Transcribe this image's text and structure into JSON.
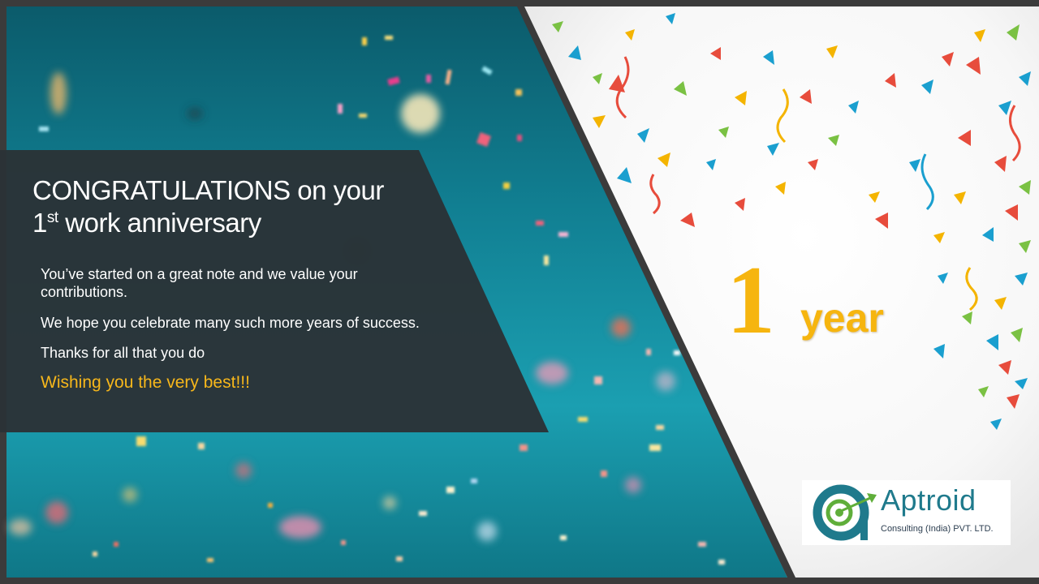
{
  "card": {
    "title_line1": "CONGRATULATIONS on your",
    "title_line2_prefix": "1",
    "title_line2_sup": "st",
    "title_line2_rest": " work anniversary",
    "paragraph1": "You’ve started on a great note and we value your contributions.",
    "paragraph2": "We hope you celebrate many such more years of success.",
    "paragraph3": "Thanks for all that you do",
    "wish": "Wishing you the very best!!!"
  },
  "anniversary": {
    "number": "1",
    "unit": "year"
  },
  "logo": {
    "word": "Aptroid",
    "subtitle": "Consulting (India) PVT. LTD.",
    "brand_color": "#1f7a8c",
    "accent_color": "#5fae3a"
  },
  "colors": {
    "teal_background": "#1a8fa0",
    "panel": "#2b3236",
    "gold": "#f6b50f",
    "border": "#3b3b3b"
  }
}
